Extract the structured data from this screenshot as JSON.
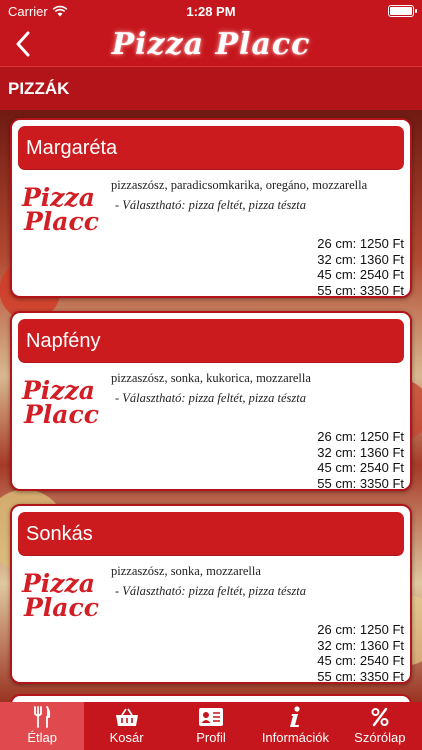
{
  "status": {
    "carrier": "Carrier",
    "time": "1:28 PM"
  },
  "header": {
    "title": "Pizza Placc"
  },
  "section": {
    "title": "PIZZÁK"
  },
  "logo": {
    "line1": "Pizza",
    "line2": "Placc"
  },
  "items": [
    {
      "name": "Margaréta",
      "description": "pizzaszósz, paradicsomkarika, oregáno, mozzarella",
      "options": "- Választható: pizza feltét, pizza tészta",
      "prices": [
        "26 cm: 1250 Ft",
        "32 cm: 1360 Ft",
        "45 cm: 2540 Ft",
        "55 cm: 3350 Ft"
      ]
    },
    {
      "name": "Napfény",
      "description": "pizzaszósz, sonka, kukorica, mozzarella",
      "options": "- Választható: pizza feltét, pizza tészta",
      "prices": [
        "26 cm: 1250 Ft",
        "32 cm: 1360 Ft",
        "45 cm: 2540 Ft",
        "55 cm: 3350 Ft"
      ]
    },
    {
      "name": "Sonkás",
      "description": "pizzaszósz, sonka, mozzarella",
      "options": "- Választható: pizza feltét, pizza tészta",
      "prices": [
        "26 cm: 1250 Ft",
        "32 cm: 1360 Ft",
        "45 cm: 2540 Ft",
        "55 cm: 3350 Ft"
      ]
    }
  ],
  "tabs": [
    {
      "label": "Étlap",
      "icon": "fork-knife-icon",
      "active": true
    },
    {
      "label": "Kosár",
      "icon": "basket-icon",
      "active": false
    },
    {
      "label": "Profil",
      "icon": "id-card-icon",
      "active": false
    },
    {
      "label": "Információk",
      "icon": "info-icon",
      "active": false
    },
    {
      "label": "Szórólap",
      "icon": "percent-icon",
      "active": false
    }
  ],
  "colors": {
    "brand_red": "#c4161c",
    "active_tab": "#e04a4e"
  }
}
